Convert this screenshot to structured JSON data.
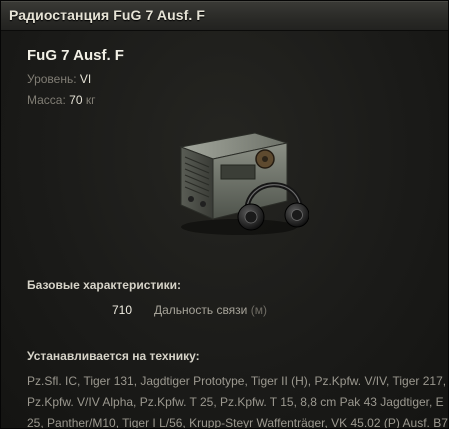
{
  "window": {
    "title": "Радиостанция FuG 7 Ausf. F"
  },
  "module": {
    "name": "FuG 7 Ausf. F",
    "tier_label": "Уровень:",
    "tier_value": "VI",
    "mass_label": "Масса:",
    "mass_value": "70",
    "mass_unit": "кг",
    "image_icon": "radio-with-headphones-icon"
  },
  "characteristics": {
    "header": "Базовые характеристики:",
    "items": [
      {
        "value": "710",
        "label": "Дальность связи",
        "unit": "(м)"
      }
    ]
  },
  "compatibility": {
    "header": "Устанавливается на технику:",
    "vehicles_text": "Pz.Sfl. IC, Tiger 131, Jagdtiger Prototype, Tiger II (H), Pz.Kpfw. V/IV, Tiger 217, Pz.Kpfw. V/IV Alpha, Pz.Kpfw. T 25, Pz.Kpfw. T 15, 8,8 cm Pak 43 Jagdtiger, E 25, Panther/M10, Tiger I L/56, Krupp-Steyr Waffenträger, VK 45.02 (P) Ausf. B7"
  }
}
